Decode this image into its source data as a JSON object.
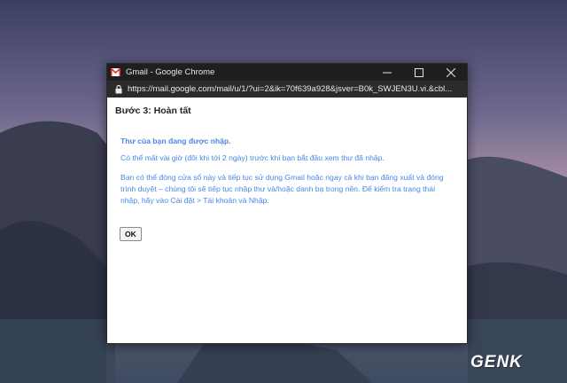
{
  "window": {
    "title": "Gmail - Google Chrome",
    "url": "https://mail.google.com/mail/u/1/?ui=2&ik=70f639a928&jsver=B0k_SWJEN3U.vi.&cbl..."
  },
  "dialog": {
    "heading": "Bước 3: Hoàn tất",
    "message_bold": "Thư của bạn đang được nhập.",
    "message_wait": "Có thể mất vài giờ (đôi khi tới 2 ngày) trước khi bạn bắt đầu xem thư đã nhập.",
    "message_info": "Bạn có thể đóng cửa sổ này và tiếp tục sử dụng Gmail hoặc ngay cả khi bạn đăng xuất và đóng trình duyệt – chúng tôi sẽ tiếp tục nhập thư và/hoặc danh bạ trong nền. Để kiểm tra trạng thái nhập, hãy vào Cài đặt > Tài khoản và Nhập.",
    "ok_label": "OK"
  },
  "watermark": {
    "text": "GENK"
  },
  "colors": {
    "link_blue": "#4a86e8",
    "titlebar": "#1f1f1f"
  }
}
